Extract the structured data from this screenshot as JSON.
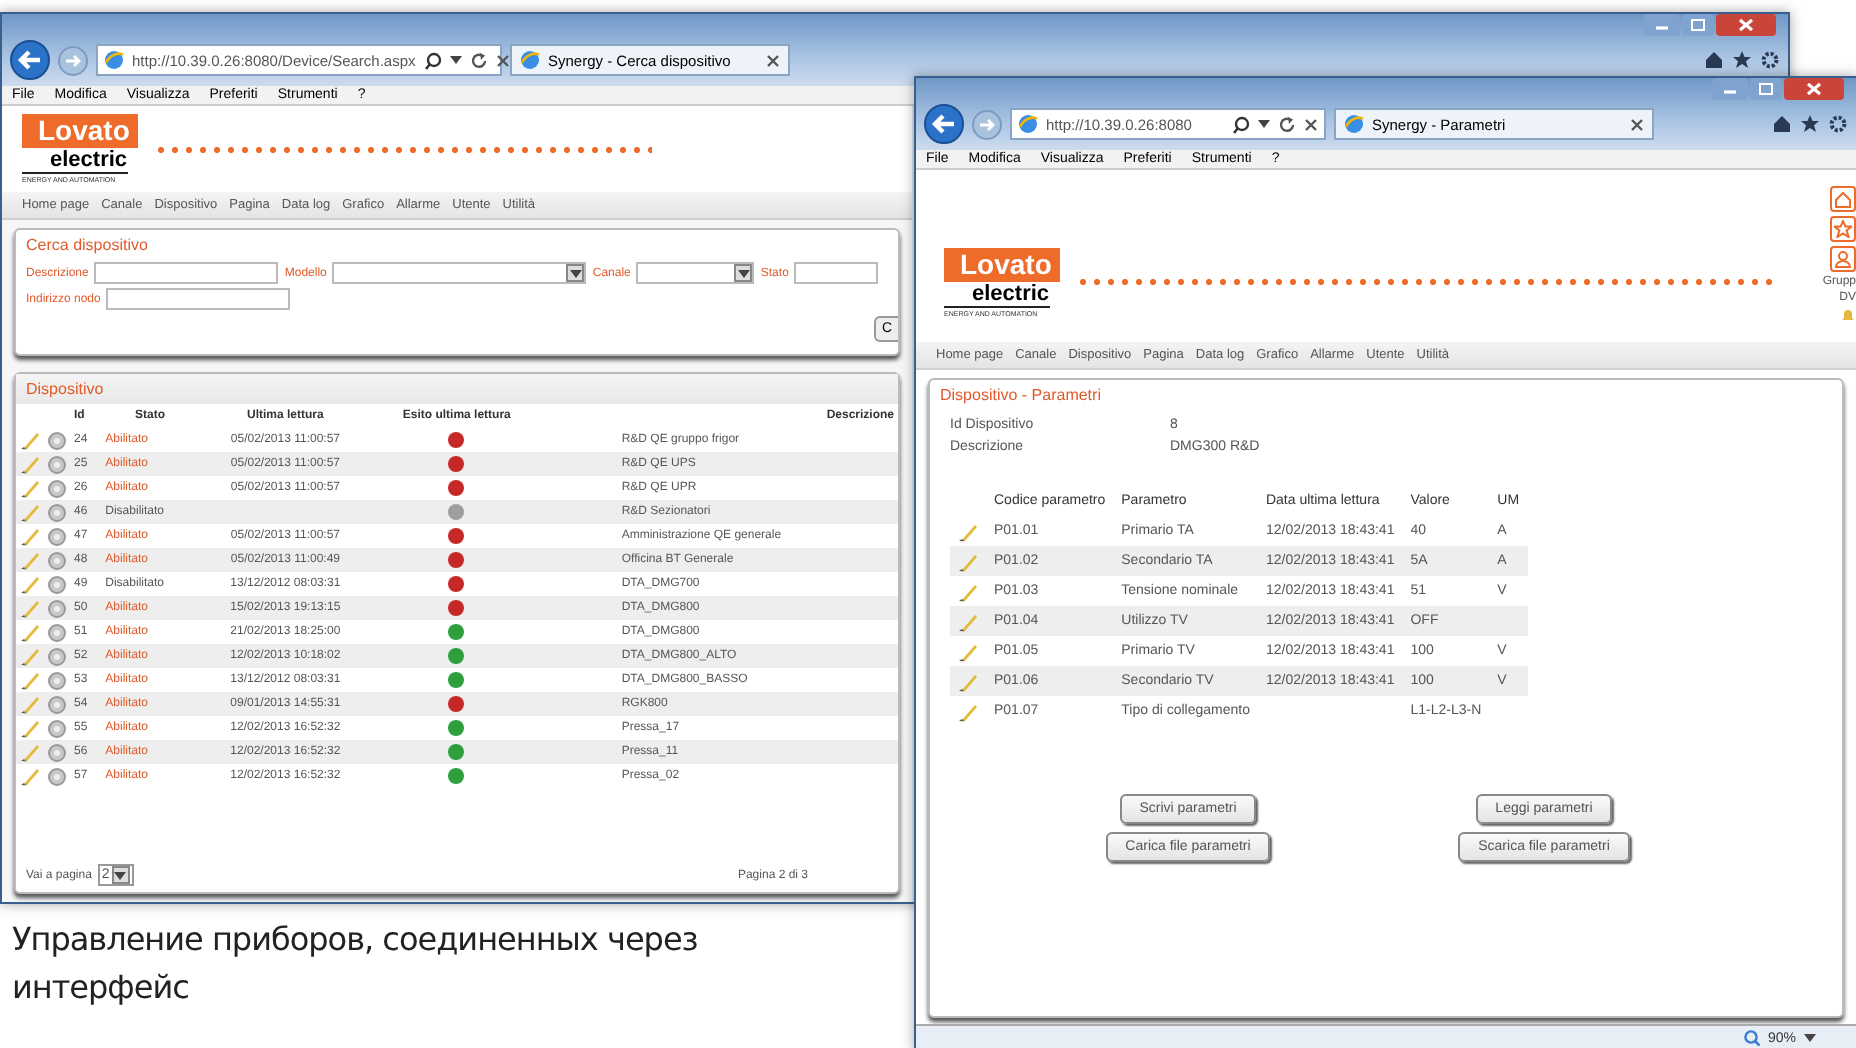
{
  "left_window": {
    "address": "http://10.39.0.26:8080/Device/Search.aspx",
    "tab": "Synergy - Cerca dispositivo",
    "menu": [
      "File",
      "Modifica",
      "Visualizza",
      "Preferiti",
      "Strumenti",
      "?"
    ],
    "logo": {
      "brand": "Lovato",
      "sub": "electric",
      "tagline": "ENERGY AND AUTOMATION"
    },
    "nav": [
      "Home page",
      "Canale",
      "Dispositivo",
      "Pagina",
      "Data log",
      "Grafico",
      "Allarme",
      "Utente",
      "Utilità"
    ],
    "search": {
      "title": "Cerca dispositivo",
      "fields": [
        {
          "label": "Descrizione",
          "kind": "text"
        },
        {
          "label": "Modello",
          "kind": "select"
        },
        {
          "label": "Canale",
          "kind": "select"
        },
        {
          "label": "Stato",
          "kind": "text"
        }
      ],
      "fields_2": [
        {
          "label": "Indirizzo nodo",
          "kind": "text"
        }
      ],
      "button": "C"
    },
    "devices": {
      "title": "Dispositivo",
      "columns": [
        "Id",
        "Stato",
        "Ultima lettura",
        "Esito ultima lettura",
        "Descrizione"
      ],
      "rows": [
        {
          "id": "24",
          "status": "Abilitato",
          "enabled": true,
          "last": "05/02/2013 11:00:57",
          "color": "#c62828",
          "description": "R&D QE gruppo frigor"
        },
        {
          "id": "25",
          "status": "Abilitato",
          "enabled": true,
          "last": "05/02/2013 11:00:57",
          "color": "#c62828",
          "description": "R&D QE UPS"
        },
        {
          "id": "26",
          "status": "Abilitato",
          "enabled": true,
          "last": "05/02/2013 11:00:57",
          "color": "#c62828",
          "description": "R&D QE UPR"
        },
        {
          "id": "46",
          "status": "Disabilitato",
          "enabled": false,
          "color": "#9e9e9e",
          "description": "R&D Sezionatori"
        },
        {
          "id": "47",
          "status": "Abilitato",
          "enabled": true,
          "last": "05/02/2013 11:00:57",
          "color": "#c62828",
          "description": "Amministrazione QE generale"
        },
        {
          "id": "48",
          "status": "Abilitato",
          "enabled": true,
          "last": "05/02/2013 11:00:49",
          "color": "#c62828",
          "description": "Officina BT Generale"
        },
        {
          "id": "49",
          "status": "Disabilitato",
          "enabled": false,
          "last": "13/12/2012 08:03:31",
          "color": "#c62828",
          "description": "DTA_DMG700"
        },
        {
          "id": "50",
          "status": "Abilitato",
          "enabled": true,
          "last": "15/02/2013 19:13:15",
          "color": "#c62828",
          "description": "DTA_DMG800"
        },
        {
          "id": "51",
          "status": "Abilitato",
          "enabled": true,
          "last": "21/02/2013 18:25:00",
          "color": "#2e9e3e",
          "description": "DTA_DMG800"
        },
        {
          "id": "52",
          "status": "Abilitato",
          "enabled": true,
          "last": "12/02/2013 10:18:02",
          "color": "#2e9e3e",
          "description": "DTA_DMG800_ALTO"
        },
        {
          "id": "53",
          "status": "Abilitato",
          "enabled": true,
          "last": "13/12/2012 08:03:31",
          "color": "#2e9e3e",
          "description": "DTA_DMG800_BASSO"
        },
        {
          "id": "54",
          "status": "Abilitato",
          "enabled": true,
          "last": "09/01/2013 14:55:31",
          "color": "#c62828",
          "description": "RGK800"
        },
        {
          "id": "55",
          "status": "Abilitato",
          "enabled": true,
          "last": "12/02/2013 16:52:32",
          "color": "#2e9e3e",
          "description": "Pressa_17"
        },
        {
          "id": "56",
          "status": "Abilitato",
          "enabled": true,
          "last": "12/02/2013 16:52:32",
          "color": "#2e9e3e",
          "description": "Pressa_11"
        },
        {
          "id": "57",
          "status": "Abilitato",
          "enabled": true,
          "last": "12/02/2013 16:52:32",
          "color": "#2e9e3e",
          "description": "Pressa_02"
        }
      ],
      "page_label": "Vai a pagina",
      "page_value": "2",
      "pager": "Pagina 2 di 3"
    }
  },
  "right_window": {
    "address": "http://10.39.0.26:8080",
    "tab": "Synergy - Parametri",
    "menu": [
      "File",
      "Modifica",
      "Visualizza",
      "Preferiti",
      "Strumenti",
      "?"
    ],
    "logo": {
      "brand": "Lovato",
      "sub": "electric",
      "tagline": "ENERGY AND AUTOMATION"
    },
    "side_texts": [
      "Grupp",
      "DV"
    ],
    "nav": [
      "Home page",
      "Canale",
      "Dispositivo",
      "Pagina",
      "Data log",
      "Grafico",
      "Allarme",
      "Utente",
      "Utilità"
    ],
    "panel": {
      "title": "Dispositivo - Parametri",
      "info": [
        {
          "label": "Id Dispositivo",
          "value": "8"
        },
        {
          "label": "Descrizione",
          "value": "DMG300 R&D"
        }
      ],
      "columns": [
        "Codice parametro",
        "Parametro",
        "Data ultima lettura",
        "Valore",
        "UM"
      ],
      "rows": [
        {
          "code": "P01.01",
          "name": "Primario TA",
          "date": "12/02/2013 18:43:41",
          "value": "40",
          "unit": "A"
        },
        {
          "code": "P01.02",
          "name": "Secondario TA",
          "date": "12/02/2013 18:43:41",
          "value": "5A",
          "unit": "A"
        },
        {
          "code": "P01.03",
          "name": "Tensione nominale",
          "date": "12/02/2013 18:43:41",
          "value": "51",
          "unit": "V"
        },
        {
          "code": "P01.04",
          "name": "Utilizzo TV",
          "date": "12/02/2013 18:43:41",
          "value": "OFF"
        },
        {
          "code": "P01.05",
          "name": "Primario TV",
          "date": "12/02/2013 18:43:41",
          "value": "100",
          "unit": "V"
        },
        {
          "code": "P01.06",
          "name": "Secondario TV",
          "date": "12/02/2013 18:43:41",
          "value": "100",
          "unit": "V"
        },
        {
          "code": "P01.07",
          "name": "Tipo di collegamento",
          "value": "L1-L2-L3-N"
        }
      ],
      "buttons": [
        [
          "Scrivi parametri",
          "Leggi parametri"
        ],
        [
          "Carica file parametri",
          "Scarica file parametri"
        ]
      ]
    },
    "zoom": "90%"
  },
  "caption": "Управление приборов, соединенных через интерфейс"
}
